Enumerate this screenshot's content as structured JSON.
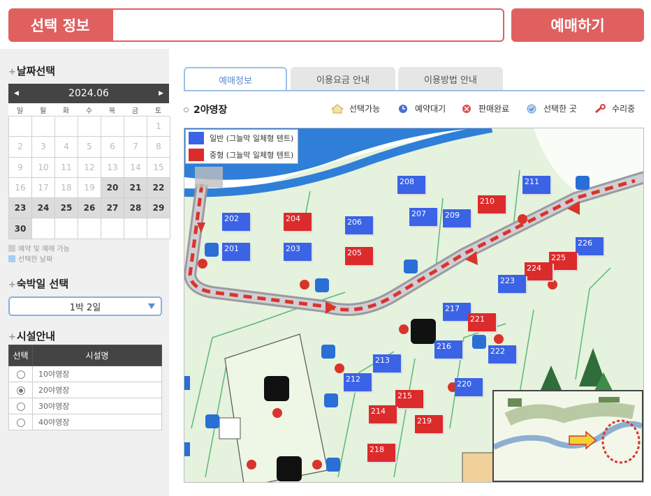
{
  "header": {
    "selection_label": "선택 정보",
    "reserve_button": "예매하기"
  },
  "sidebar": {
    "date_title": "날짜선택",
    "calendar": {
      "month": "2024.06",
      "weekdays": [
        "일",
        "월",
        "화",
        "수",
        "목",
        "금",
        "토"
      ],
      "cells": [
        "",
        "",
        "",
        "",
        "",
        "",
        "1",
        "2",
        "3",
        "4",
        "5",
        "6",
        "7",
        "8",
        "9",
        "10",
        "11",
        "12",
        "13",
        "14",
        "15",
        "16",
        "17",
        "18",
        "19",
        "20",
        "21",
        "22",
        "23",
        "24",
        "25",
        "26",
        "27",
        "28",
        "29",
        "30",
        "",
        "",
        "",
        "",
        "",
        ""
      ],
      "available_from": 20
    },
    "legend_available": "예약 및 예매 가능",
    "legend_selected": "선택한 날짜",
    "stay_title": "숙박일 선택",
    "stay_value": "1박 2일",
    "facility_title": "시설안내",
    "facility_headers": [
      "선택",
      "시설명"
    ],
    "facilities": [
      {
        "name": "10야영장",
        "selected": false
      },
      {
        "name": "20야영장",
        "selected": true
      },
      {
        "name": "30야영장",
        "selected": false
      },
      {
        "name": "40야영장",
        "selected": false
      }
    ]
  },
  "tabs": [
    "예매정보",
    "이용요금 안내",
    "이용방법 안내"
  ],
  "site_title": "2야영장",
  "status_legend": [
    "선택가능",
    "예약대기",
    "판매완료",
    "선택한 곳",
    "수리중"
  ],
  "map": {
    "legend": [
      {
        "label": "일반 (그늘막 일체형 텐트)",
        "color": "#3b63e6"
      },
      {
        "label": "중형 (그늘막 일체형 텐트)",
        "color": "#dc2b2b"
      }
    ],
    "sites": [
      {
        "no": "202",
        "type": "blue"
      },
      {
        "no": "204",
        "type": "red"
      },
      {
        "no": "206",
        "type": "blue"
      },
      {
        "no": "201",
        "type": "blue"
      },
      {
        "no": "203",
        "type": "blue"
      },
      {
        "no": "205",
        "type": "red"
      },
      {
        "no": "208",
        "type": "blue"
      },
      {
        "no": "207",
        "type": "blue"
      },
      {
        "no": "209",
        "type": "blue"
      },
      {
        "no": "210",
        "type": "red"
      },
      {
        "no": "211",
        "type": "blue"
      },
      {
        "no": "226",
        "type": "blue"
      },
      {
        "no": "225",
        "type": "red"
      },
      {
        "no": "224",
        "type": "red"
      },
      {
        "no": "223",
        "type": "blue"
      },
      {
        "no": "217",
        "type": "blue"
      },
      {
        "no": "221",
        "type": "red"
      },
      {
        "no": "216",
        "type": "blue"
      },
      {
        "no": "222",
        "type": "blue"
      },
      {
        "no": "213",
        "type": "blue"
      },
      {
        "no": "212",
        "type": "blue"
      },
      {
        "no": "220",
        "type": "blue"
      },
      {
        "no": "215",
        "type": "red"
      },
      {
        "no": "214",
        "type": "red"
      },
      {
        "no": "219",
        "type": "red"
      },
      {
        "no": "218",
        "type": "red"
      }
    ]
  }
}
